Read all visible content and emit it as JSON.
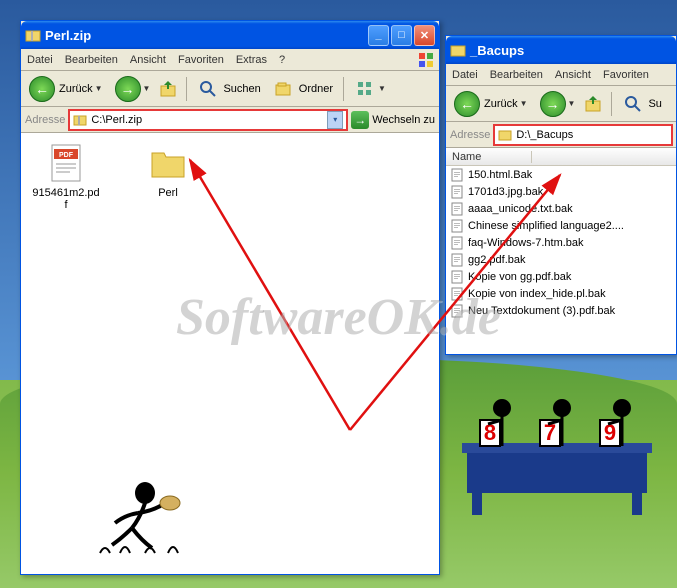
{
  "window_left": {
    "title": "Perl.zip",
    "menu": [
      "Datei",
      "Bearbeiten",
      "Ansicht",
      "Favoriten",
      "Extras",
      "?"
    ],
    "toolbar": {
      "back": "Zurück",
      "search": "Suchen",
      "folders": "Ordner"
    },
    "address": {
      "label": "Adresse",
      "value": "C:\\Perl.zip",
      "go": "Wechseln zu"
    },
    "files": [
      {
        "name": "915461m2.pdf",
        "type": "pdf"
      },
      {
        "name": "Perl",
        "type": "folder"
      }
    ]
  },
  "window_right": {
    "title": "_Bacups",
    "menu": [
      "Datei",
      "Bearbeiten",
      "Ansicht",
      "Favoriten"
    ],
    "toolbar": {
      "back": "Zurück",
      "search_short": "Su"
    },
    "address": {
      "label": "Adresse",
      "value": "D:\\_Bacups"
    },
    "list_header": "Name",
    "files": [
      "150.html.Bak",
      "1701d3.jpg.bak",
      "aaaa_unicode.txt.bak",
      "Chinese simplified language2....",
      "faq-Windows-7.htm.bak",
      "gg2.pdf.bak",
      "Kopie von gg.pdf.bak",
      "Kopie von index_hide.pl.bak",
      "Neu Textdokument (3).pdf.bak"
    ]
  },
  "watermark": "SoftwareOK.de",
  "judges_scores": [
    "8",
    "7",
    "9"
  ]
}
